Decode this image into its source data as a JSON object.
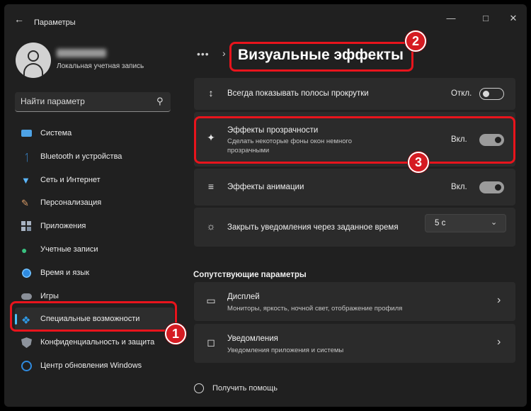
{
  "window": {
    "title": "Параметры",
    "back_icon": "back-arrow-icon",
    "controls": [
      "minimize-icon",
      "maximize-icon",
      "close-icon"
    ]
  },
  "user": {
    "account_type": "Локальная учетная запись"
  },
  "search": {
    "placeholder": "Найти параметр",
    "icon": "search-icon"
  },
  "sidebar": {
    "items": [
      {
        "label": "Система",
        "icon": "system-icon"
      },
      {
        "label": "Bluetooth и устройства",
        "icon": "bluetooth-icon"
      },
      {
        "label": "Сеть и Интернет",
        "icon": "wifi-icon"
      },
      {
        "label": "Персонализация",
        "icon": "brush-icon"
      },
      {
        "label": "Приложения",
        "icon": "apps-icon"
      },
      {
        "label": "Учетные записи",
        "icon": "accounts-icon"
      },
      {
        "label": "Время и язык",
        "icon": "globe-clock-icon"
      },
      {
        "label": "Игры",
        "icon": "gamepad-icon"
      },
      {
        "label": "Специальные возможности",
        "icon": "accessibility-icon",
        "active": true
      },
      {
        "label": "Конфиденциальность и защита",
        "icon": "shield-icon"
      },
      {
        "label": "Центр обновления Windows",
        "icon": "update-icon"
      }
    ],
    "accent_color": "#4cc2ff"
  },
  "breadcrumb": {
    "overflow": "•••",
    "separator": "›",
    "title": "Визуальные эффекты"
  },
  "settings": [
    {
      "title": "Всегда показывать полосы прокрутки",
      "state": "Откл.",
      "toggle_on": false,
      "icon": "scrollbar-arrows-icon"
    },
    {
      "title": "Эффекты прозрачности",
      "subtitle": "Сделать некоторые фоны окон немного прозрачными",
      "state": "Вкл.",
      "toggle_on": true,
      "icon": "transparency-icon"
    },
    {
      "title": "Эффекты анимации",
      "state": "Вкл.",
      "toggle_on": true,
      "icon": "animation-icon"
    },
    {
      "title": "Закрыть уведомления через заданное время",
      "value": "5 с",
      "icon": "brightness-icon"
    }
  ],
  "related": {
    "heading": "Сопутствующие параметры",
    "items": [
      {
        "title": "Дисплей",
        "subtitle": "Мониторы, яркость, ночной свет, отображение профиля",
        "icon": "monitor-icon"
      },
      {
        "title": "Уведомления",
        "subtitle": "Уведомления приложения и системы",
        "icon": "bell-icon"
      }
    ]
  },
  "help": {
    "label": "Получить помощь",
    "icon": "help-icon"
  },
  "annotations": {
    "badges": [
      "1",
      "2",
      "3"
    ],
    "color": "#e8141c"
  }
}
